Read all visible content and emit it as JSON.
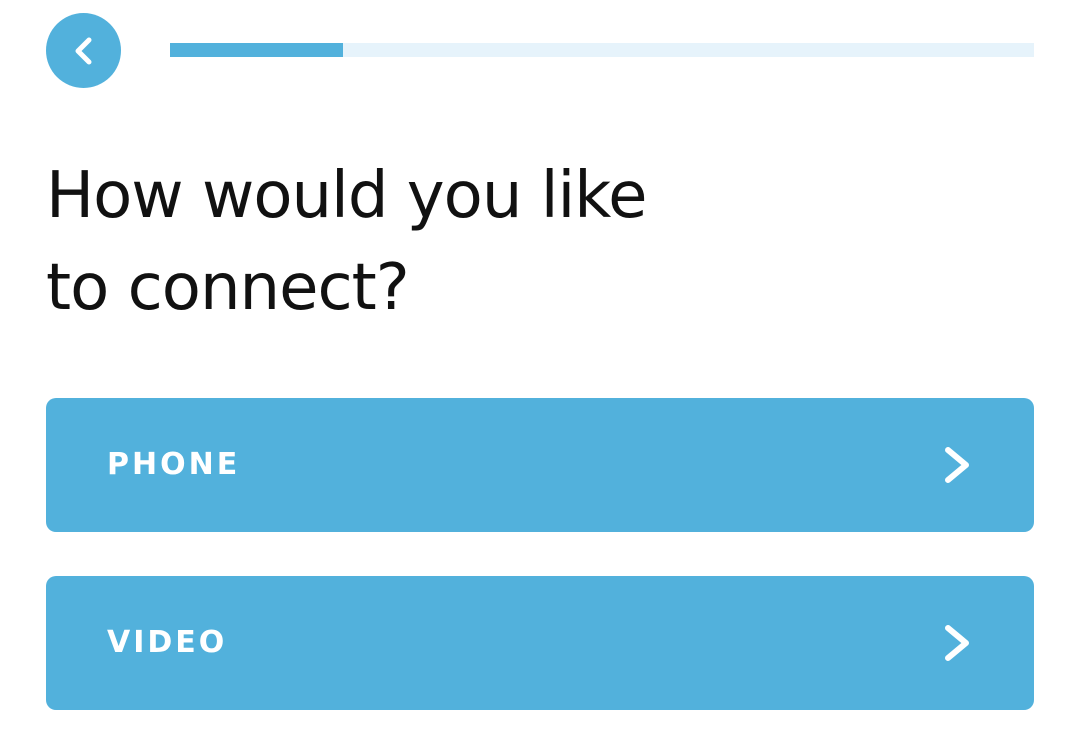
{
  "header": {
    "back_icon": "chevron-left-icon",
    "progress_fraction": 0.2
  },
  "title": {
    "line1": "How would you like",
    "line2": "to connect?"
  },
  "options": [
    {
      "label": "PHONE",
      "icon": "chevron-right-icon"
    },
    {
      "label": "VIDEO",
      "icon": "chevron-right-icon"
    }
  ],
  "colors": {
    "accent": "#52b1dc",
    "track": "#e6f3fb",
    "text": "#111111",
    "button_text": "#ffffff"
  }
}
